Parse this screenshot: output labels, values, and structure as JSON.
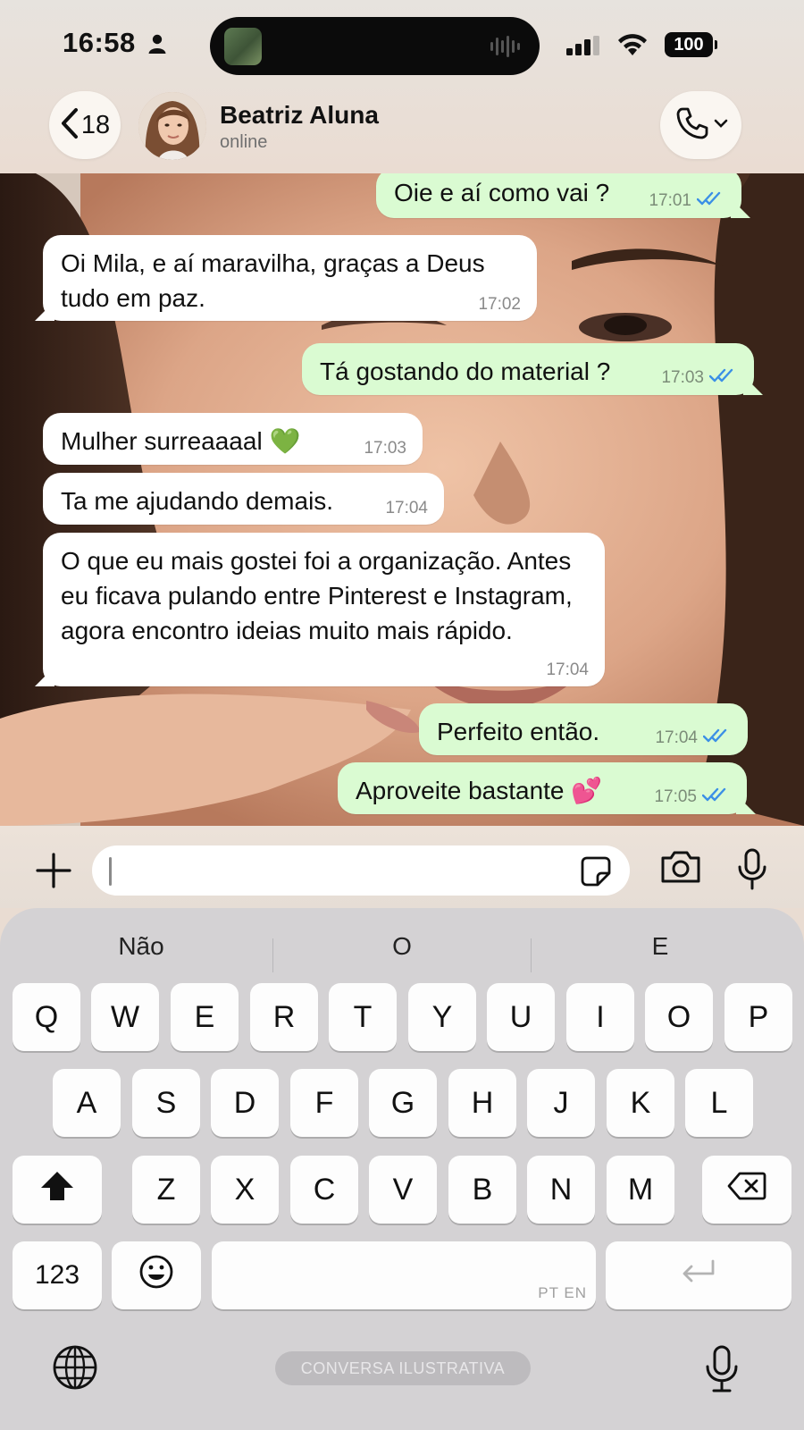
{
  "status_bar": {
    "time": "16:58",
    "battery": "100"
  },
  "header": {
    "back_count": "18",
    "contact_name": "Beatriz Aluna",
    "contact_status": "online"
  },
  "messages": [
    {
      "direction": "out",
      "text": "Oie e aí como vai ?",
      "time": "17:01",
      "read": true
    },
    {
      "direction": "in",
      "text": "Oi Mila, e aí maravilha, graças a Deus tudo em paz.",
      "time": "17:02"
    },
    {
      "direction": "out",
      "text": "Tá gostando do material ?",
      "time": "17:03",
      "read": true
    },
    {
      "direction": "in",
      "text": "Mulher surreaaaal 💚",
      "time": "17:03"
    },
    {
      "direction": "in",
      "text": "Ta me ajudando demais.",
      "time": "17:04"
    },
    {
      "direction": "in",
      "text": "O que eu mais gostei foi a organização. Antes eu ficava pulando entre Pinterest e Instagram, agora encontro ideias muito mais rápido.",
      "time": "17:04"
    },
    {
      "direction": "out",
      "text": "Perfeito então.",
      "time": "17:04",
      "read": true
    },
    {
      "direction": "out",
      "text": "Aproveite bastante 💕",
      "time": "17:05",
      "read": true
    }
  ],
  "input": {
    "placeholder": ""
  },
  "keyboard": {
    "suggestions": [
      "Não",
      "O",
      "E"
    ],
    "row1": [
      "Q",
      "W",
      "E",
      "R",
      "T",
      "Y",
      "U",
      "I",
      "O",
      "P"
    ],
    "row2": [
      "A",
      "S",
      "D",
      "F",
      "G",
      "H",
      "J",
      "K",
      "L"
    ],
    "row3": [
      "Z",
      "X",
      "C",
      "V",
      "B",
      "N",
      "M"
    ],
    "numbers_label": "123",
    "space_hint": "PT EN"
  },
  "watermark": "CONVERSA ILUSTRATIVA",
  "colors": {
    "outgoing_bubble": "#dafbd2",
    "incoming_bubble": "#ffffff",
    "read_ticks": "#3b8fe6"
  }
}
